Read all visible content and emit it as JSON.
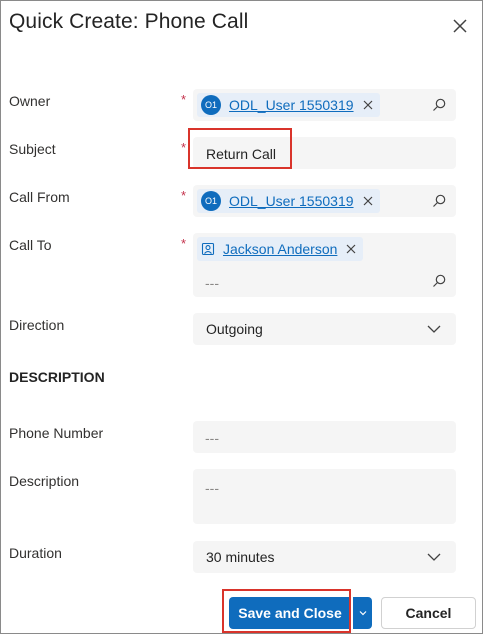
{
  "dialog": {
    "title": "Quick Create: Phone Call"
  },
  "fields": {
    "owner": {
      "label": "Owner",
      "required_mark": "*",
      "tag": {
        "initials": "O1",
        "name": "ODL_User 1550319"
      }
    },
    "subject": {
      "label": "Subject",
      "required_mark": "*",
      "value": "Return Call"
    },
    "call_from": {
      "label": "Call From",
      "required_mark": "*",
      "tag": {
        "initials": "O1",
        "name": "ODL_User 1550319"
      }
    },
    "call_to": {
      "label": "Call To",
      "required_mark": "*",
      "tag": {
        "name": "Jackson Anderson"
      },
      "placeholder": "---"
    },
    "direction": {
      "label": "Direction",
      "value": "Outgoing"
    }
  },
  "description_section": {
    "heading": "DESCRIPTION",
    "phone_number": {
      "label": "Phone Number",
      "placeholder": "---"
    },
    "description": {
      "label": "Description",
      "placeholder": "---"
    },
    "duration": {
      "label": "Duration",
      "value": "30 minutes"
    }
  },
  "footer": {
    "save_label": "Save and Close",
    "cancel_label": "Cancel"
  },
  "colors": {
    "accent": "#0f6cbd",
    "required": "#c4314b",
    "highlight": "#d9342b",
    "field_bg": "#f5f5f5",
    "tag_bg": "#e6eef8"
  }
}
